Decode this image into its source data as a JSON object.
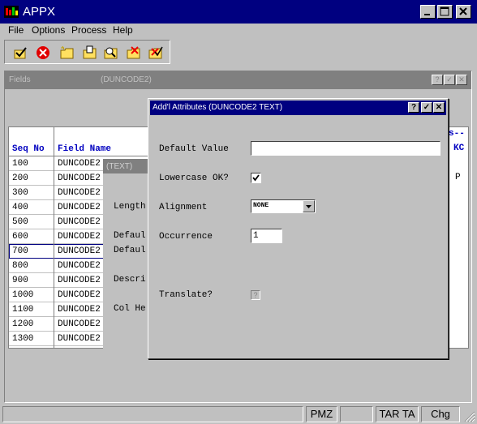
{
  "app": {
    "title": "APPX"
  },
  "menu": [
    "File",
    "Options",
    "Process",
    "Help"
  ],
  "toolbar": [
    "ok-check-icon",
    "cancel-icon",
    "new-folder-icon",
    "open-folder-icon",
    "search-folder-icon",
    "delete-folder-icon",
    "folder-check-icon"
  ],
  "fields_window": {
    "title": "Fields",
    "subtitle": "(DUNCODE2)",
    "columns": {
      "seq": "Seq No",
      "field": "Field Name"
    },
    "right_header": "s--",
    "right_col": "KC",
    "right_value": "P",
    "rows": [
      {
        "seq": "100",
        "field": "DUNCODE2"
      },
      {
        "seq": "200",
        "field": "DUNCODE2"
      },
      {
        "seq": "300",
        "field": "DUNCODE2"
      },
      {
        "seq": "400",
        "field": "DUNCODE2"
      },
      {
        "seq": "500",
        "field": "DUNCODE2"
      },
      {
        "seq": "600",
        "field": "DUNCODE2"
      },
      {
        "seq": "700",
        "field": "DUNCODE2"
      },
      {
        "seq": "800",
        "field": "DUNCODE2"
      },
      {
        "seq": "900",
        "field": "DUNCODE2"
      },
      {
        "seq": "1000",
        "field": "DUNCODE2"
      },
      {
        "seq": "1100",
        "field": "DUNCODE2"
      },
      {
        "seq": "1200",
        "field": "DUNCODE2"
      },
      {
        "seq": "1300",
        "field": "DUNCODE2"
      }
    ]
  },
  "text_window": {
    "title": "(TEXT)",
    "labels": [
      "Length",
      "Defaul",
      "Defaul",
      "Descri",
      "Col He"
    ]
  },
  "dialog": {
    "title": "Add'l Attributes (DUNCODE2 TEXT)",
    "default_value_label": "Default Value",
    "default_value": "",
    "lowercase_label": "Lowercase OK?",
    "lowercase_checked": true,
    "alignment_label": "Alignment",
    "alignment_value": "NONE",
    "occurrence_label": "Occurrence",
    "occurrence_value": "1",
    "translate_label": "Translate?",
    "translate_value": "?"
  },
  "status": [
    "PMZ",
    "TAR TA",
    "Chg"
  ]
}
